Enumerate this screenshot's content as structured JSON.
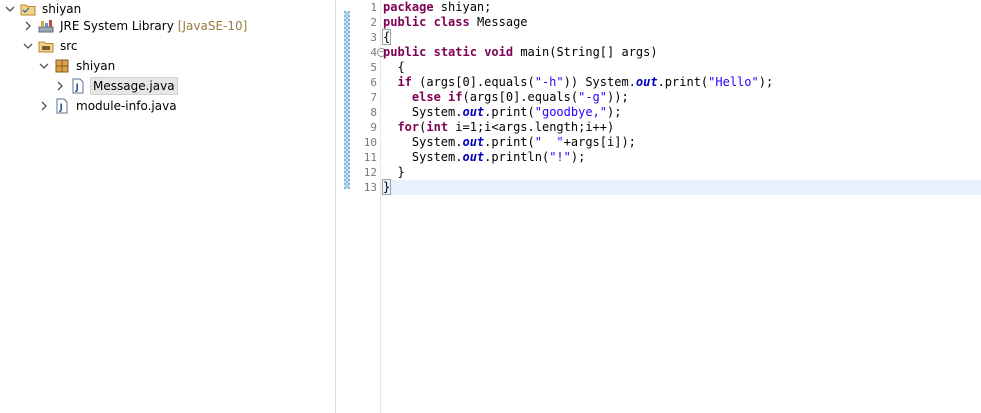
{
  "explorer": {
    "items": [
      {
        "id": "project",
        "label": "shiyan",
        "twisty": "expanded",
        "icon": "java-project-icon",
        "level": 0
      },
      {
        "id": "jre",
        "label": "JRE System Library",
        "decoration": "[JavaSE-10]",
        "twisty": "collapsed",
        "icon": "library-icon",
        "level": 1
      },
      {
        "id": "src",
        "label": "src",
        "twisty": "expanded",
        "icon": "source-folder-icon",
        "level": 1
      },
      {
        "id": "pkg",
        "label": "shiyan",
        "twisty": "expanded",
        "icon": "package-icon",
        "level": 2
      },
      {
        "id": "message",
        "label": "Message.java",
        "twisty": "collapsed",
        "icon": "java-file-icon",
        "level": 3,
        "selected": true
      },
      {
        "id": "module",
        "label": "module-info.java",
        "twisty": "collapsed",
        "icon": "java-file-icon",
        "level": 2
      }
    ]
  },
  "editor": {
    "line_numbers": [
      "1",
      "2",
      "3",
      "4",
      "5",
      "6",
      "7",
      "8",
      "9",
      "10",
      "11",
      "12",
      "13"
    ],
    "fold_line_glyph": "⊖",
    "current_line": 13,
    "lines": [
      [
        {
          "t": "kw",
          "v": "package"
        },
        {
          "t": "n",
          "v": " shiyan;"
        }
      ],
      [
        {
          "t": "kw",
          "v": "public"
        },
        {
          "t": "n",
          "v": " "
        },
        {
          "t": "kw",
          "v": "class"
        },
        {
          "t": "n",
          "v": " Message"
        }
      ],
      [
        {
          "t": "brace",
          "v": "{"
        }
      ],
      [
        {
          "t": "kw",
          "v": "public"
        },
        {
          "t": "n",
          "v": " "
        },
        {
          "t": "kw",
          "v": "static"
        },
        {
          "t": "n",
          "v": " "
        },
        {
          "t": "kw",
          "v": "void"
        },
        {
          "t": "n",
          "v": " main(String[] args)"
        }
      ],
      [
        {
          "t": "n",
          "v": "  {"
        }
      ],
      [
        {
          "t": "n",
          "v": "  "
        },
        {
          "t": "kw",
          "v": "if"
        },
        {
          "t": "n",
          "v": " (args[0].equals("
        },
        {
          "t": "str",
          "v": "\"-h\""
        },
        {
          "t": "n",
          "v": ")) System."
        },
        {
          "t": "fld",
          "v": "out"
        },
        {
          "t": "n",
          "v": ".print("
        },
        {
          "t": "str",
          "v": "\"Hello\""
        },
        {
          "t": "n",
          "v": ");"
        }
      ],
      [
        {
          "t": "n",
          "v": "    "
        },
        {
          "t": "kw",
          "v": "else"
        },
        {
          "t": "n",
          "v": " "
        },
        {
          "t": "kw",
          "v": "if"
        },
        {
          "t": "n",
          "v": "(args[0].equals("
        },
        {
          "t": "str",
          "v": "\"-g\""
        },
        {
          "t": "n",
          "v": "));"
        }
      ],
      [
        {
          "t": "n",
          "v": "    System."
        },
        {
          "t": "fld",
          "v": "out"
        },
        {
          "t": "n",
          "v": ".print("
        },
        {
          "t": "str",
          "v": "\"goodbye,\""
        },
        {
          "t": "n",
          "v": ");"
        }
      ],
      [
        {
          "t": "n",
          "v": "  "
        },
        {
          "t": "kw",
          "v": "for"
        },
        {
          "t": "n",
          "v": "("
        },
        {
          "t": "kw",
          "v": "int"
        },
        {
          "t": "n",
          "v": " i=1;i<args.length;i++)"
        }
      ],
      [
        {
          "t": "n",
          "v": "    System."
        },
        {
          "t": "fld",
          "v": "out"
        },
        {
          "t": "n",
          "v": ".print("
        },
        {
          "t": "str",
          "v": "\"  \""
        },
        {
          "t": "n",
          "v": "+args[i]);"
        }
      ],
      [
        {
          "t": "n",
          "v": "    System."
        },
        {
          "t": "fld",
          "v": "out"
        },
        {
          "t": "n",
          "v": ".println("
        },
        {
          "t": "str",
          "v": "\"!\""
        },
        {
          "t": "n",
          "v": ");"
        }
      ],
      [
        {
          "t": "n",
          "v": "  }"
        }
      ],
      [
        {
          "t": "brace",
          "v": "}"
        },
        {
          "t": "caret",
          "v": ""
        }
      ]
    ]
  },
  "colors": {
    "keyword": "#7f0055",
    "string": "#2a00ff",
    "field": "#0000c0",
    "current_line": "#e8f2fe",
    "selection": "#e6e6e6"
  }
}
